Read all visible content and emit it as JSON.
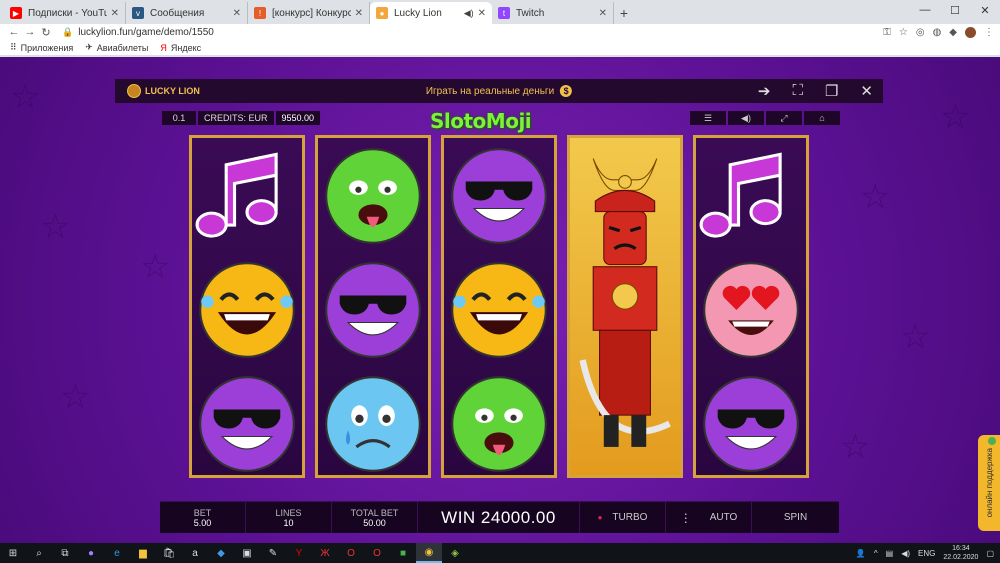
{
  "browser": {
    "tabs": [
      {
        "title": "Подписки - YouTube",
        "favicon_color": "#ff0000",
        "active": false
      },
      {
        "title": "Сообщения",
        "favicon_color": "#2a5885",
        "active": false
      },
      {
        "title": "[конкурс] Конкурс скриншотов",
        "favicon_color": "#e55d2b",
        "active": false
      },
      {
        "title": "Lucky Lion",
        "favicon_color": "#f3a63b",
        "active": true
      },
      {
        "title": "Twitch",
        "favicon_color": "#9146ff",
        "active": false
      }
    ],
    "url": "luckylion.fun/game/demo/1550",
    "bookmarks": [
      {
        "label": "Приложения",
        "icon": "apps-grid-icon"
      },
      {
        "label": "Авиабилеты",
        "icon": "plane-icon"
      },
      {
        "label": "Яндекс",
        "icon": "yandex-icon"
      }
    ]
  },
  "game": {
    "header": {
      "logo_text": "LUCKY LION",
      "real_money_label": "Играть на реальные деньги",
      "coin_symbol": "$"
    },
    "credits": {
      "bet_small": "0.1",
      "label": "CREDITS: EUR",
      "value": "9550.00"
    },
    "title": "SlotoMoji",
    "reels": [
      [
        "music-note",
        "laughing-tears",
        "sunglasses-purple"
      ],
      [
        "sick-green",
        "sunglasses-purple",
        "sad-blue"
      ],
      [
        "sunglasses-purple",
        "laughing-tears",
        "sick-green"
      ],
      [
        "samurai"
      ],
      [
        "music-note",
        "heart-eyes",
        "sunglasses-purple"
      ]
    ],
    "controls": {
      "bet_label": "BET",
      "bet_value": "5.00",
      "lines_label": "LINES",
      "lines_value": "10",
      "total_bet_label": "TOTAL BET",
      "total_bet_value": "50.00",
      "win_text": "WIN 24000.00",
      "turbo_label": "TURBO",
      "auto_label": "AUTO",
      "spin_label": "SPIN"
    },
    "support_label": "онлайн поддержка"
  },
  "taskbar": {
    "lang": "ENG",
    "time": "16:34",
    "date": "22.02.2020"
  },
  "colors": {
    "background": "#5c1194",
    "reel_border": "#d6a23a",
    "accent_gold": "#f0c14b"
  }
}
